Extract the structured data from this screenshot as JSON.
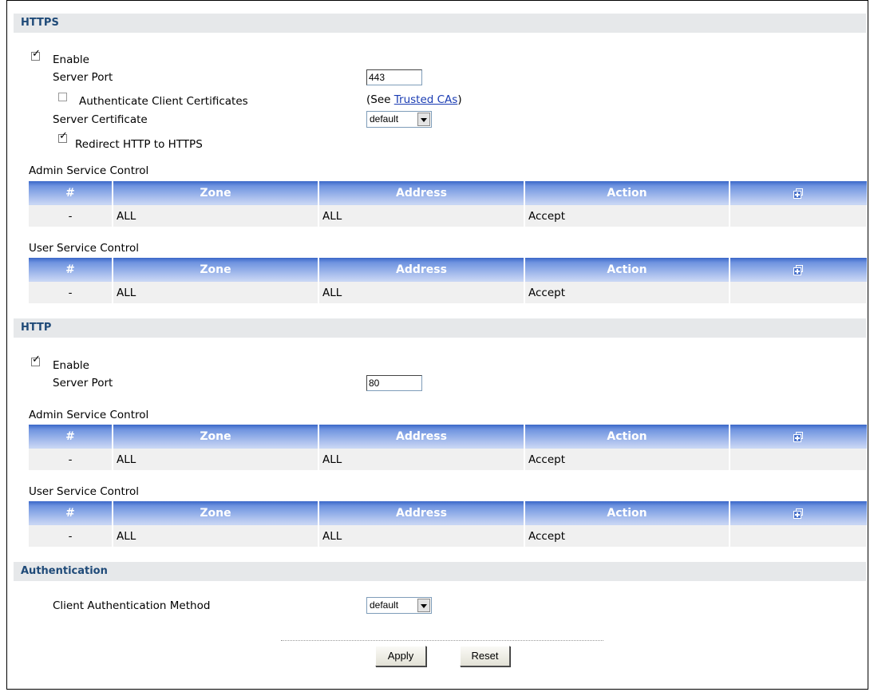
{
  "https": {
    "title": "HTTPS",
    "enable_label": "Enable",
    "enable_checked": true,
    "server_port_label": "Server Port",
    "server_port_value": "443",
    "auth_client_cert_label": "Authenticate Client Certificates",
    "auth_client_cert_checked": false,
    "see_prefix": "(See ",
    "trusted_cas_link": "Trusted CAs",
    "see_suffix": ")",
    "server_cert_label": "Server Certificate",
    "server_cert_value": "default",
    "redirect_label": "Redirect HTTP to HTTPS",
    "redirect_checked": true,
    "admin_control_title": "Admin Service Control",
    "user_control_title": "User Service Control"
  },
  "http": {
    "title": "HTTP",
    "enable_label": "Enable",
    "enable_checked": true,
    "server_port_label": "Server Port",
    "server_port_value": "80",
    "admin_control_title": "Admin Service Control",
    "user_control_title": "User Service Control"
  },
  "table": {
    "headers": [
      "#",
      "Zone",
      "Address",
      "Action"
    ],
    "add_icon": "add-rule-icon",
    "row": [
      "-",
      "ALL",
      "ALL",
      "Accept"
    ]
  },
  "authentication": {
    "title": "Authentication",
    "method_label": "Client Authentication Method",
    "method_value": "default"
  },
  "buttons": {
    "apply": "Apply",
    "reset": "Reset"
  },
  "colors": {
    "section_bar": "#e6e8ea",
    "section_title": "#1f4a78",
    "table_header": "#3a67c8",
    "table_row": "#f0f0f0",
    "link": "#1a3cb3"
  }
}
